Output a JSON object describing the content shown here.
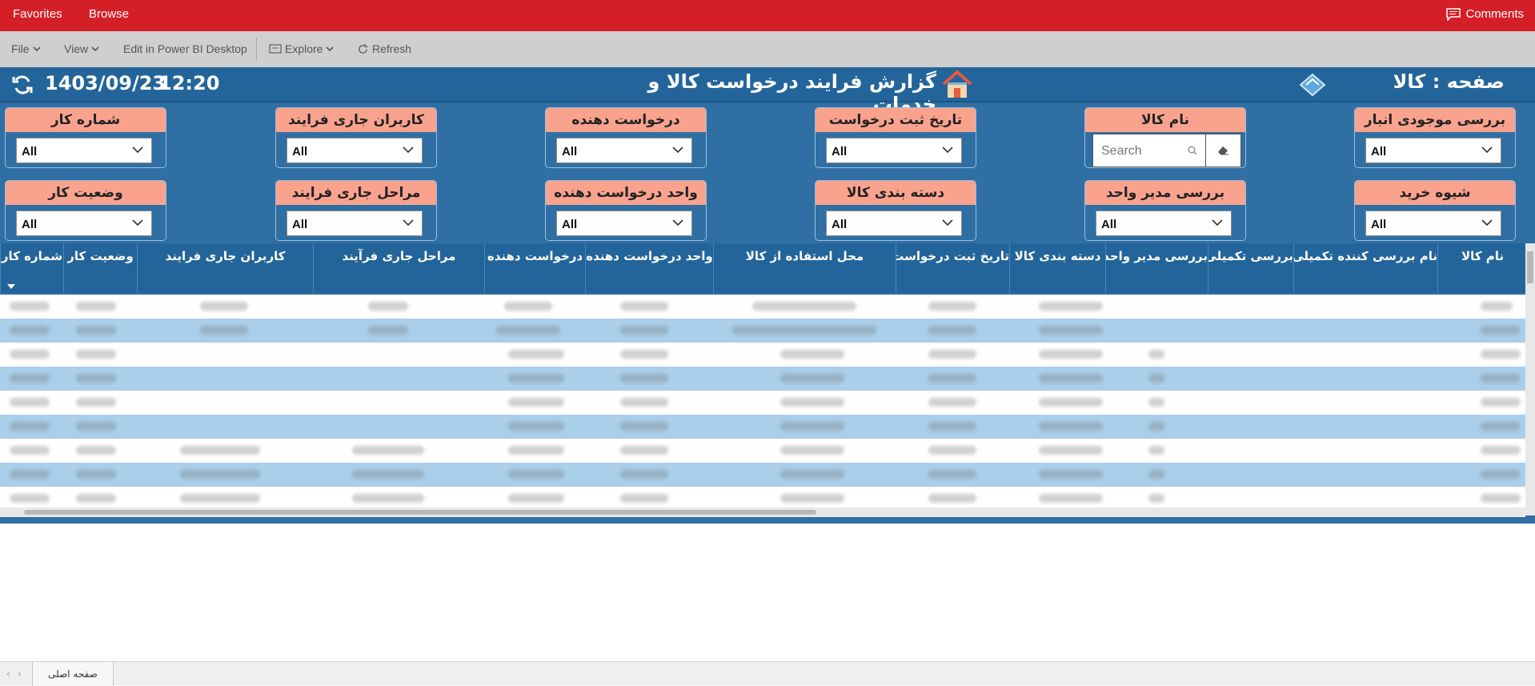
{
  "topbar": {
    "favorites": "Favorites",
    "browse": "Browse",
    "comments": "Comments"
  },
  "toolbar": {
    "file": "File",
    "view": "View",
    "edit": "Edit in Power BI Desktop",
    "explore": "Explore",
    "refresh": "Refresh"
  },
  "header": {
    "date": "1403/09/23",
    "time": "12:20",
    "title": "گزارش فرایند درخواست کالا و خدمات",
    "page_label": "صفحه :  کالا"
  },
  "slicers": [
    {
      "label": "بررسی موجودی انبار",
      "value": "All"
    },
    {
      "label": "نام کالا",
      "value": "Search"
    },
    {
      "label": "تاریخ ثبت درخواست",
      "value": "All"
    },
    {
      "label": "درخواست دهنده",
      "value": "All"
    },
    {
      "label": "کاربران جاری فرایند",
      "value": "All"
    },
    {
      "label": "شماره کار",
      "value": "All"
    },
    {
      "label": "شیوه خرید",
      "value": "All"
    },
    {
      "label": "بررسی مدیر واحد",
      "value": "All"
    },
    {
      "label": "دسته بندی کالا",
      "value": "All"
    },
    {
      "label": "واحد درخواست دهنده",
      "value": "All"
    },
    {
      "label": "مراحل جاری فرایند",
      "value": "All"
    },
    {
      "label": "وضعیت کار",
      "value": "All"
    }
  ],
  "table": {
    "columns": [
      "نام کالا",
      "نام بررسی کننده تکمیلی",
      "بررسی تکمیلی",
      "بررسی مدیر واحد",
      "دسته بندی کالا",
      "تاریخ ثبت درخواست",
      "محل استفاده از کالا",
      "واحد درخواست دهنده",
      "درخواست دهنده",
      "مراحل جاری فرآیند",
      "کاربران جاری فرایند",
      "وضعیت کار",
      "شماره کار"
    ]
  },
  "footer": {
    "page_tab": "صفحه اصلی"
  },
  "colors": {
    "brand_red": "#d51f26",
    "report_blue": "#2f6fa3",
    "slicer_salmon": "#f9a38e",
    "row_light": "#a9cfea"
  }
}
